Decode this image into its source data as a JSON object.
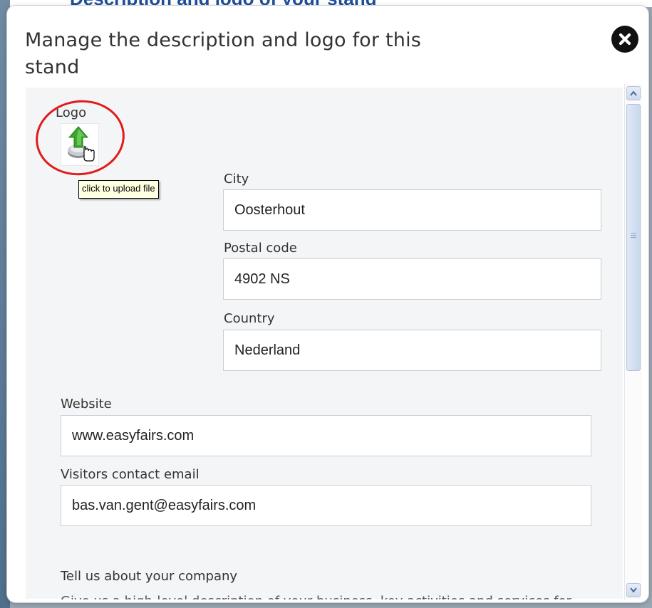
{
  "page": {
    "background_heading": "Description and logo of your stand"
  },
  "dialog": {
    "title": "Manage the description and logo for this stand",
    "close_icon": "close-icon"
  },
  "logo": {
    "label": "Logo",
    "icon": "upload-arrow-icon",
    "tooltip": "click to upload file"
  },
  "fields": {
    "city": {
      "label": "City",
      "value": "Oosterhout"
    },
    "postal_code": {
      "label": "Postal code",
      "value": "4902 NS"
    },
    "country": {
      "label": "Country",
      "value": "Nederland"
    },
    "website": {
      "label": "Website",
      "value": "www.easyfairs.com"
    },
    "visitors_email": {
      "label": "Visitors contact email",
      "value": "bas.van.gent@easyfairs.com"
    }
  },
  "company": {
    "heading": "Tell us about your company",
    "intro": "Give us a high-level description of your business, key activities and services for"
  },
  "colors": {
    "highlight": "#e01b1b",
    "tooltip_bg": "#ffffe1",
    "scroll_area_bg": "#f4f5f6"
  }
}
